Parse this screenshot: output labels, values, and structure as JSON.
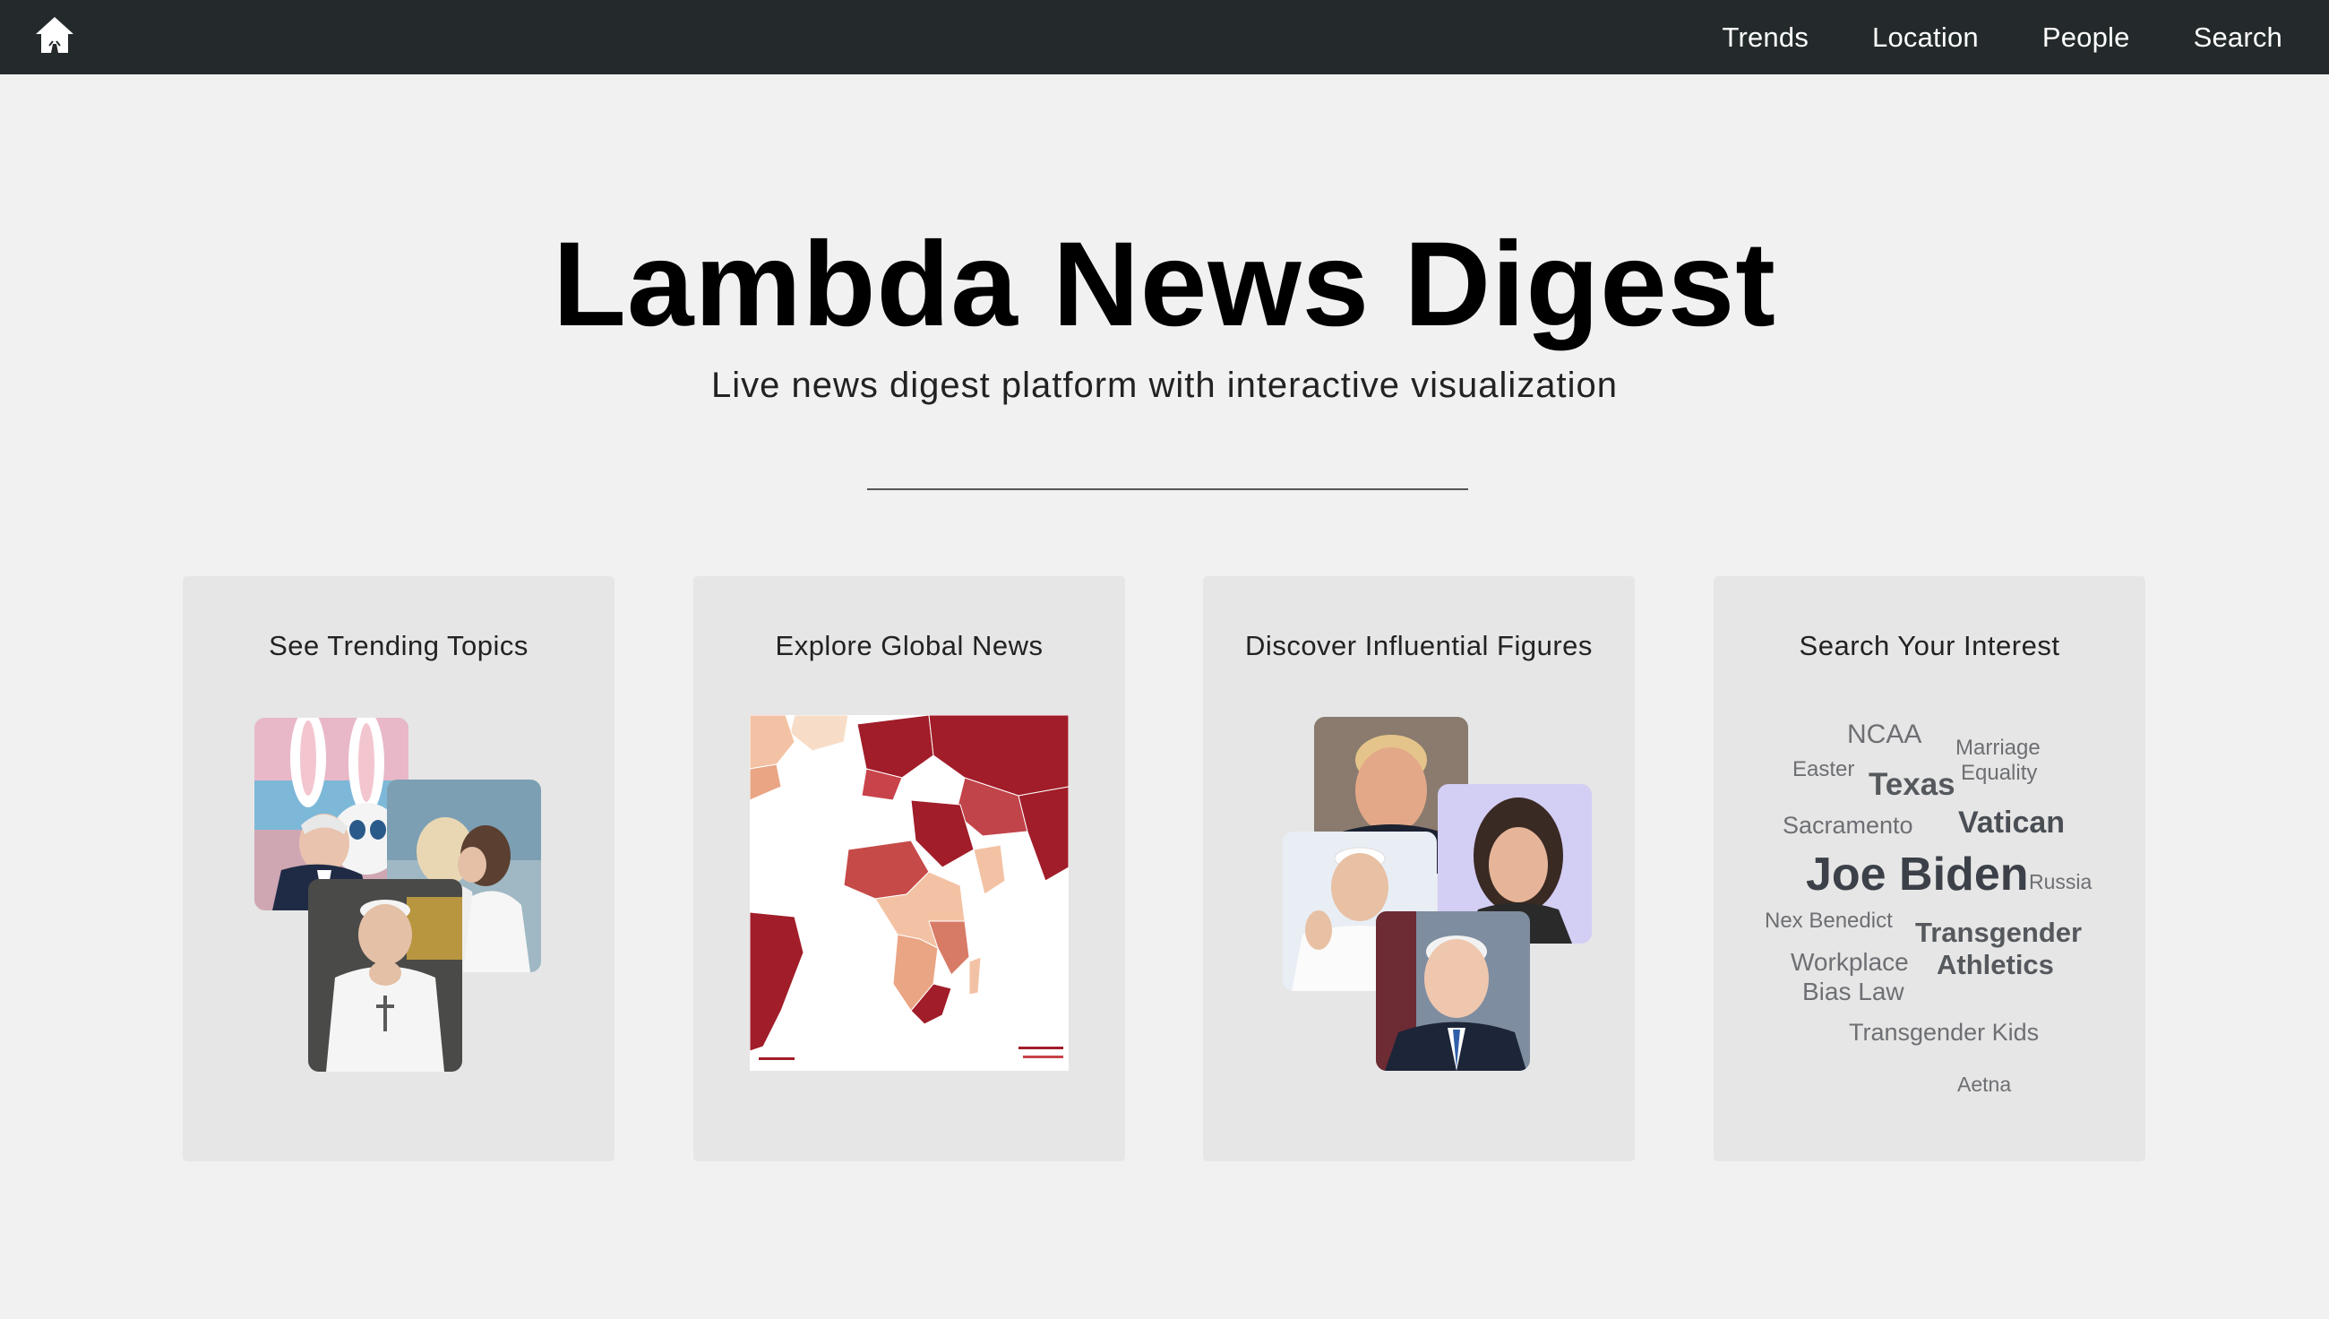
{
  "nav": {
    "home_icon": "home-icon",
    "links": [
      "Trends",
      "Location",
      "People",
      "Search"
    ]
  },
  "hero": {
    "title": "Lambda News Digest",
    "subtitle": "Live news digest platform with interactive visualization"
  },
  "cards": [
    {
      "title": "See Trending Topics"
    },
    {
      "title": "Explore Global News"
    },
    {
      "title": "Discover Influential Figures"
    },
    {
      "title": "Search Your Interest"
    }
  ],
  "wordcloud": {
    "words": [
      "NCAA",
      "Marriage",
      "Equality",
      "Easter",
      "Texas",
      "Sacramento",
      "Vatican",
      "Joe Biden",
      "Russia",
      "Nex Benedict",
      "Transgender",
      "Workplace",
      "Athletics",
      "Bias Law",
      "Transgender Kids",
      "Aetna"
    ]
  },
  "colors": {
    "navbar": "#242a2b",
    "background": "#f1f1f1",
    "card": "#e6e6e6",
    "map_dark": "#a11d29",
    "map_light": "#f3c2a4"
  }
}
